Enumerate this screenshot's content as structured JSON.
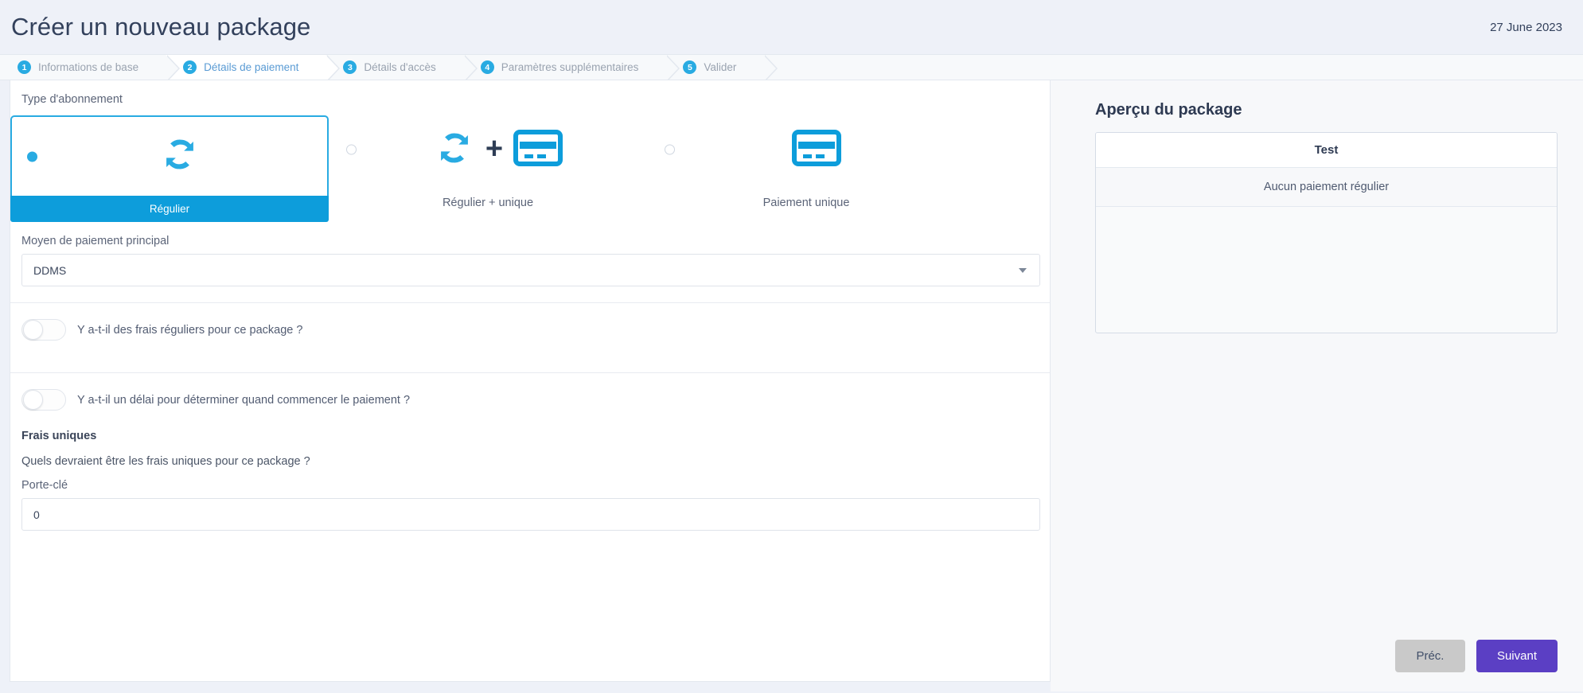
{
  "header": {
    "title": "Créer un nouveau package",
    "date": "27 June 2023"
  },
  "wizard": {
    "steps": [
      {
        "num": "1",
        "label": "Informations de base"
      },
      {
        "num": "2",
        "label": "Détails de paiement"
      },
      {
        "num": "3",
        "label": "Détails d'accès"
      },
      {
        "num": "4",
        "label": "Paramètres supplémentaires"
      },
      {
        "num": "5",
        "label": "Valider"
      }
    ]
  },
  "form": {
    "subscription_type_label": "Type d'abonnement",
    "options": [
      {
        "label": "Régulier",
        "icon": "recurring-icon",
        "selected": true
      },
      {
        "label": "Régulier + unique",
        "icon": "recurring-plus-card-icon",
        "selected": false
      },
      {
        "label": "Paiement unique",
        "icon": "credit-card-icon",
        "selected": false
      }
    ],
    "payment_method_label": "Moyen de paiement principal",
    "payment_method_value": "DDMS",
    "toggle_recurring_fees": "Y a-t-il des frais réguliers pour ce package ?",
    "toggle_delay": "Y a-t-il un délai pour déterminer quand commencer le paiement ?",
    "one_off_heading": "Frais uniques",
    "one_off_question": "Quels devraient être les frais uniques pour ce package ?",
    "keyring_label": "Porte-clé",
    "keyring_value": "0"
  },
  "preview": {
    "title": "Aperçu du package",
    "card_title": "Test",
    "card_body": "Aucun paiement régulier"
  },
  "footer": {
    "prev_label": "Préc.",
    "next_label": "Suivant"
  },
  "colors": {
    "accent_blue": "#29abe2",
    "select_blue": "#0d9ddb",
    "next_purple": "#5b3fc4",
    "prev_grey": "#c9c9c9"
  }
}
